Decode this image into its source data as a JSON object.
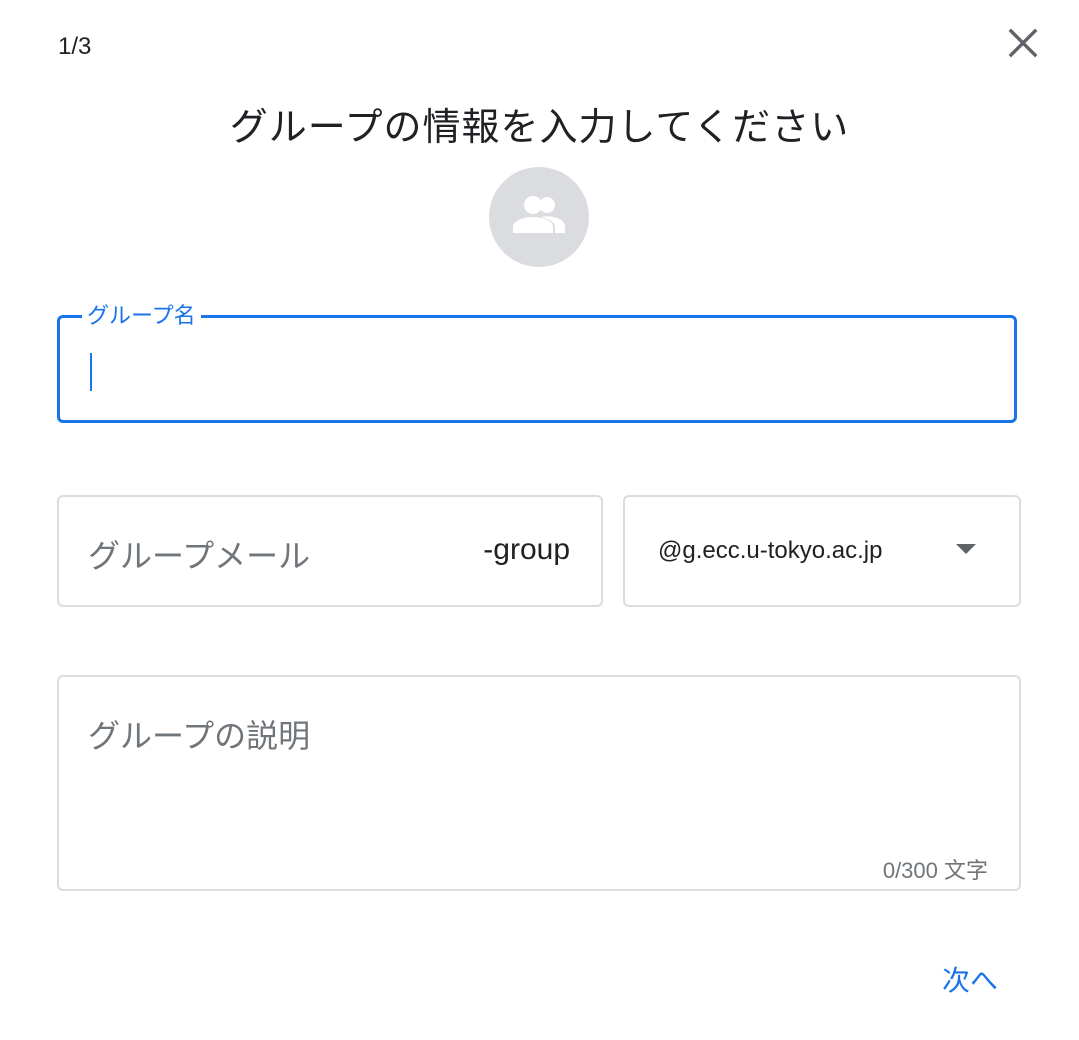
{
  "header": {
    "step_indicator": "1/3",
    "close_icon": "close-icon",
    "title": "グループの情報を入力してください"
  },
  "avatar": {
    "icon": "group-icon",
    "background_color": "#dadce0"
  },
  "form": {
    "group_name": {
      "label": "グループ名",
      "value": "",
      "focused": true
    },
    "group_email": {
      "placeholder": "グループメール",
      "value": "",
      "suffix": "-group"
    },
    "domain": {
      "selected": "@g.ecc.u-tokyo.ac.jp"
    },
    "description": {
      "placeholder": "グループの説明",
      "value": "",
      "char_count": "0/300 文字"
    }
  },
  "footer": {
    "next_label": "次へ"
  },
  "colors": {
    "accent": "#1a73e8",
    "border": "#dadce0",
    "text": "#202124",
    "muted": "#70757a"
  }
}
